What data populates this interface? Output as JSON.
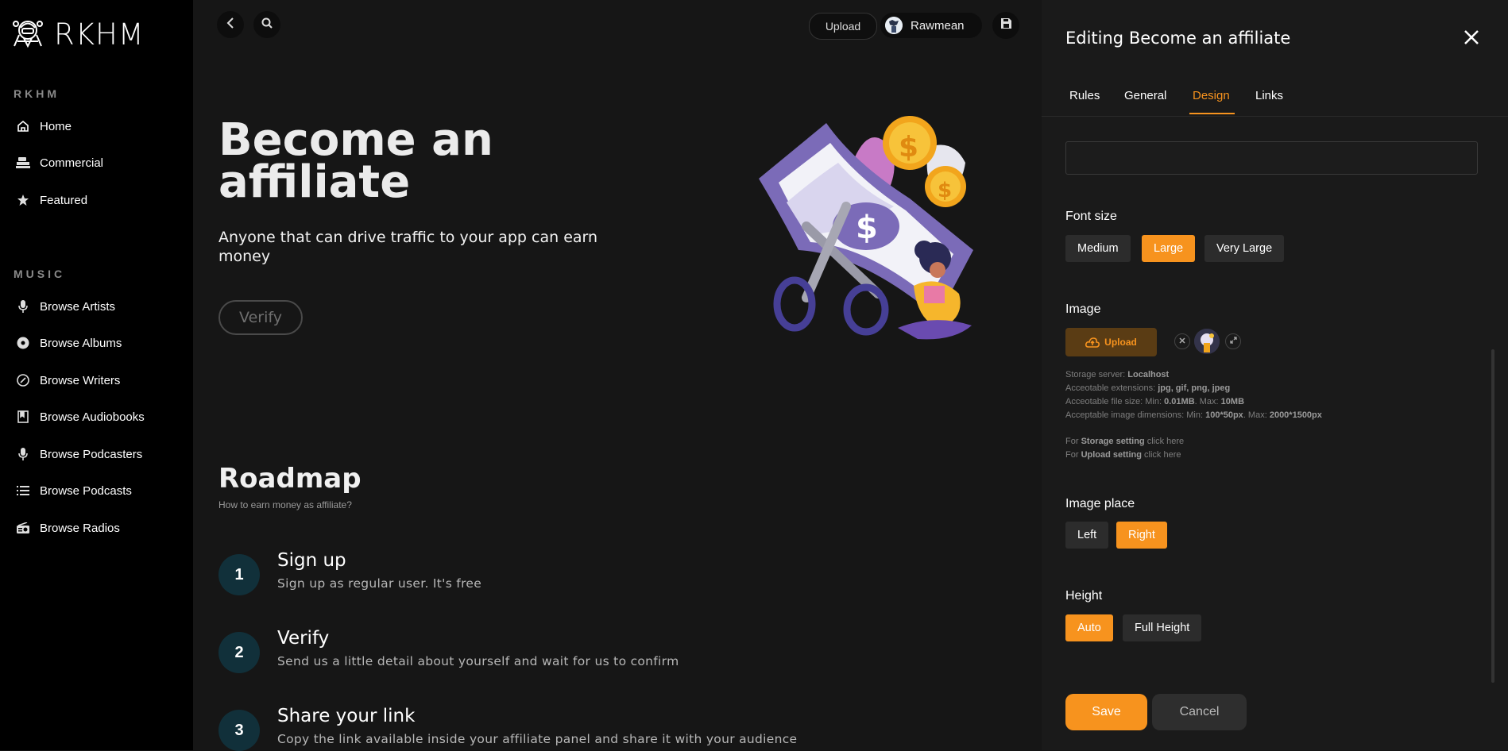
{
  "app": {
    "name": "RKHM"
  },
  "sidebar": {
    "section_main": "RKHM",
    "main_items": [
      {
        "label": "Home",
        "icon": "home-icon"
      },
      {
        "label": "Commercial",
        "icon": "commercial-icon"
      },
      {
        "label": "Featured",
        "icon": "star-icon"
      }
    ],
    "section_music": "MUSIC",
    "music_items": [
      {
        "label": "Browse Artists",
        "icon": "microphone-icon"
      },
      {
        "label": "Browse Albums",
        "icon": "disc-icon"
      },
      {
        "label": "Browse Writers",
        "icon": "compass-icon"
      },
      {
        "label": "Browse Audiobooks",
        "icon": "book-icon"
      },
      {
        "label": "Browse Podcasters",
        "icon": "microphone-icon"
      },
      {
        "label": "Browse Podcasts",
        "icon": "list-icon"
      },
      {
        "label": "Browse Radios",
        "icon": "radio-icon"
      }
    ]
  },
  "topbar": {
    "upload_label": "Upload",
    "user_name": "Rawmean"
  },
  "hero": {
    "title": "Become an affiliate",
    "subtitle": "Anyone that can drive traffic to your app can earn money",
    "button": "Verify"
  },
  "roadmap": {
    "title": "Roadmap",
    "subtitle": "How to earn money as affiliate?",
    "steps": [
      {
        "num": "1",
        "title": "Sign up",
        "desc": "Sign up as regular user. It's free"
      },
      {
        "num": "2",
        "title": "Verify",
        "desc": "Send us a little detail about yourself and wait for us to confirm"
      },
      {
        "num": "3",
        "title": "Share your link",
        "desc": "Copy the link available inside your affiliate panel and share it with your audience"
      }
    ]
  },
  "panel": {
    "title": "Editing Become an affiliate",
    "tabs": [
      "Rules",
      "General",
      "Design",
      "Links"
    ],
    "active_tab": "Design",
    "input_value": "",
    "font_size": {
      "label": "Font size",
      "options": [
        "Medium",
        "Large",
        "Very Large"
      ],
      "selected": "Large"
    },
    "image": {
      "label": "Image",
      "upload_button": "Upload",
      "storage_server_label": "Storage server:",
      "storage_server_value": "Localhost",
      "ext_label": "Acceotable extensions:",
      "ext_value": "jpg, gif, png, jpeg",
      "size_label": "Acceotable file size: Min:",
      "size_min": "0.01MB",
      "size_max_label": ". Max:",
      "size_max": "10MB",
      "dim_label": "Acceptable image dimensions: Min:",
      "dim_min": "100*50px",
      "dim_max_label": ". Max:",
      "dim_max": "2000*1500px",
      "for_label": "For",
      "storage_setting": "Storage setting",
      "upload_setting": "Upload setting",
      "click_here": "click here"
    },
    "image_place": {
      "label": "Image place",
      "options": [
        "Left",
        "Right"
      ],
      "selected": "Right"
    },
    "height": {
      "label": "Height",
      "options": [
        "Auto",
        "Full Height"
      ],
      "selected": "Auto"
    },
    "save": "Save",
    "cancel": "Cancel"
  },
  "colors": {
    "accent": "#f7931e",
    "sidebar_bg": "#000000",
    "main_bg": "#161616",
    "panel_bg": "#1a1a1a"
  }
}
